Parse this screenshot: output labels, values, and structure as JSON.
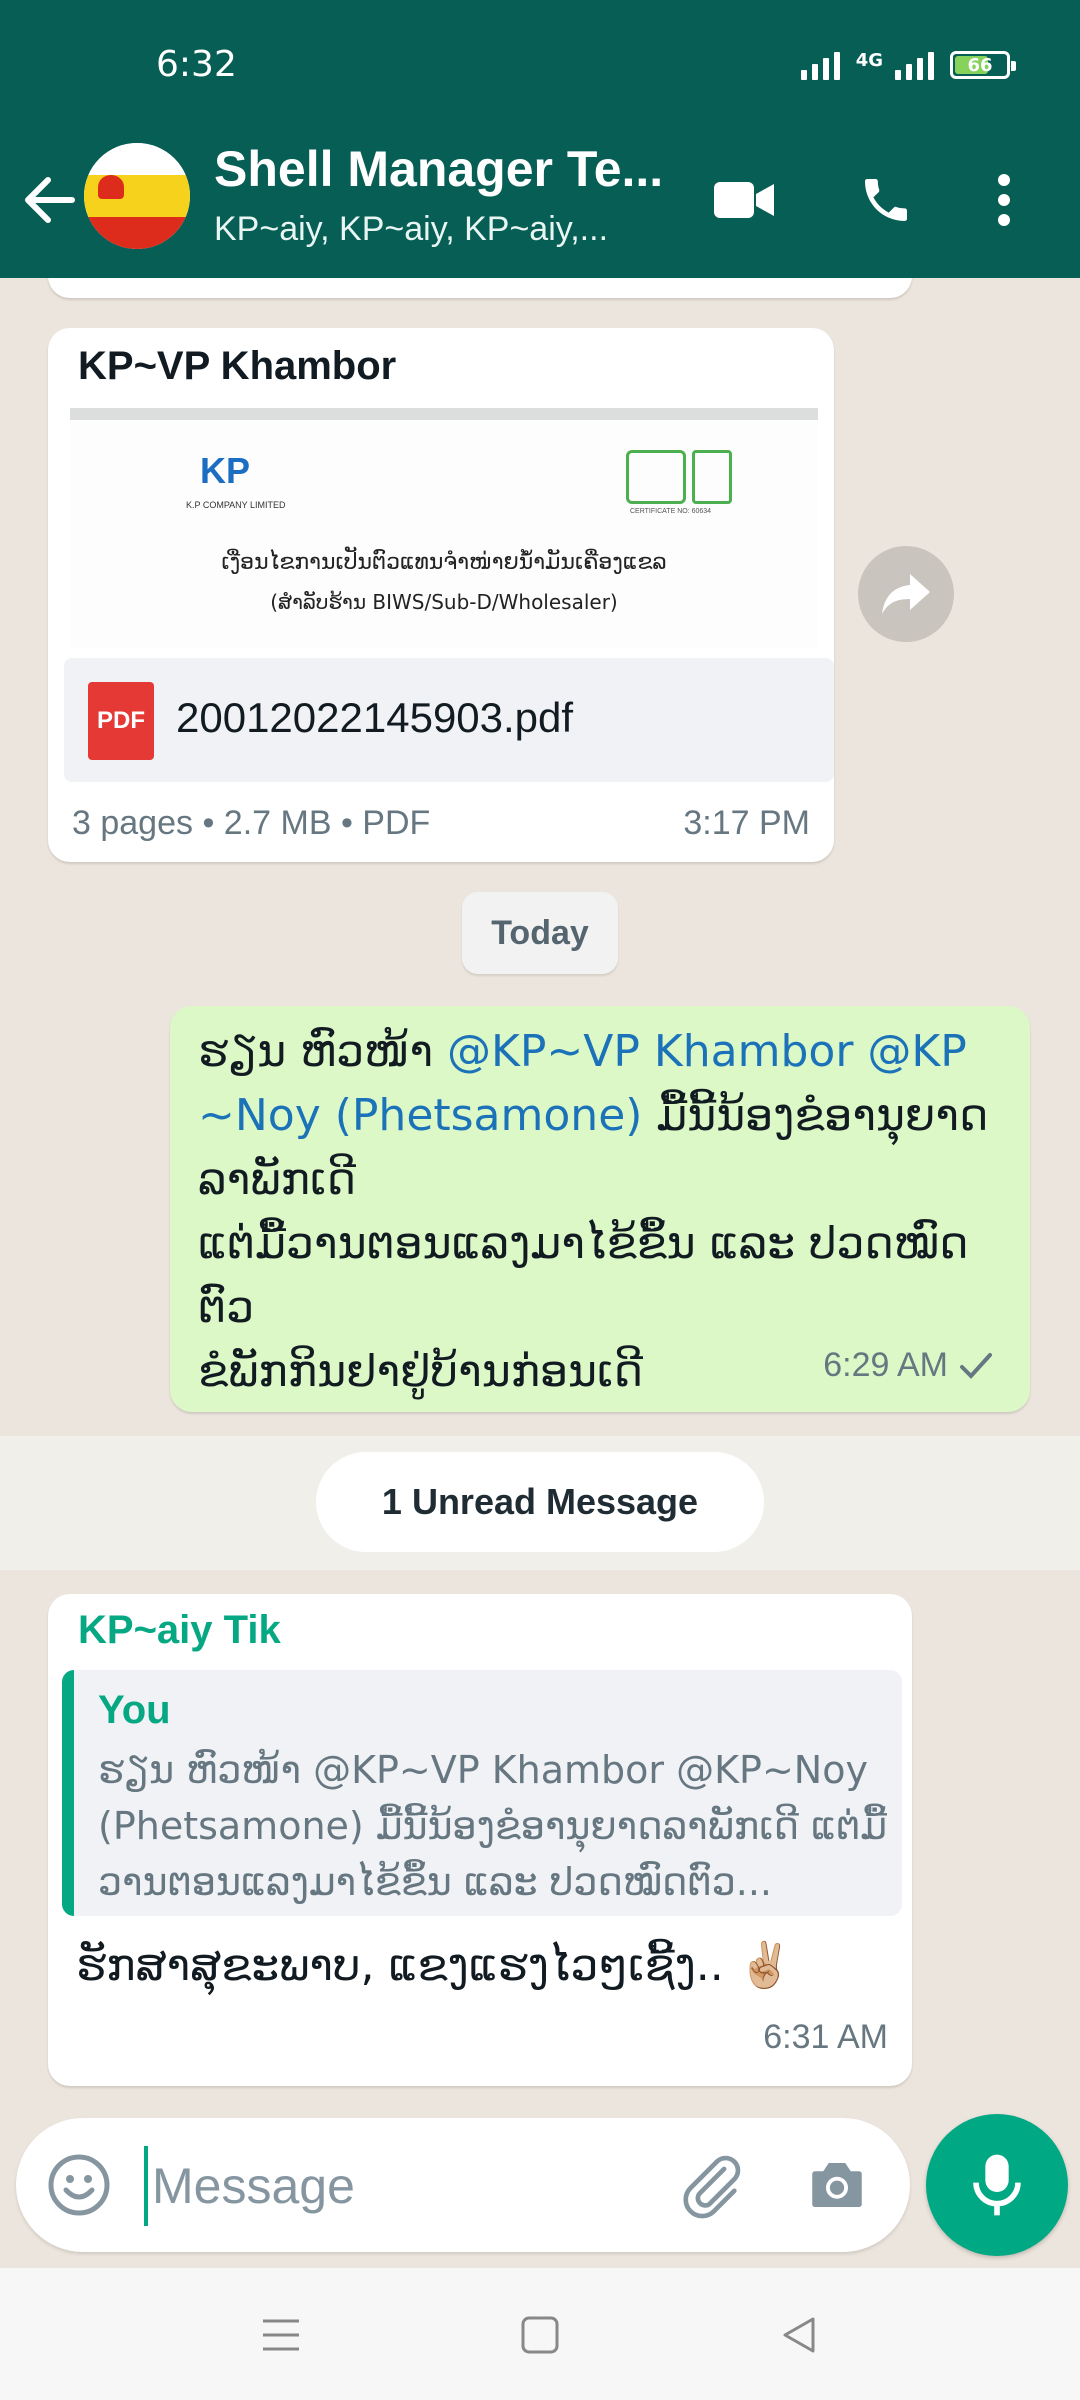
{
  "status_bar": {
    "time": "6:32",
    "network": "4G",
    "battery": "66",
    "battery_level": 0.66
  },
  "header": {
    "back_icon": "arrow-back-icon",
    "title": "Shell Manager Te...",
    "subtitle": "KP~aiy, KP~aiy, KP~aiy,...",
    "video_icon": "video-call-icon",
    "call_icon": "voice-call-icon",
    "menu_icon": "more-vert-icon"
  },
  "messages": [
    {
      "sender": "KP~VP Khambor",
      "sender_color": "#1b72b8",
      "doc_preview": {
        "company": "K.P COMPANY LIMITED",
        "logo_text": "KP",
        "cert_text": "CERTIFICATE NO: 60634",
        "line1": "ເງື່ອນໄຂການເປັນຕົວແທນຈຳໜ່າຍນ້ຳມັນເຄື່ອງແຂລ",
        "line2": "(ສຳລັບຮ້ານ  BIWS/Sub-D/Wholesaler)"
      },
      "file_name": "20012022145903.pdf",
      "file_type_icon": "PDF",
      "file_meta": "3 pages • 2.7 MB • PDF",
      "time": "3:17 PM",
      "forward_icon": "forward-icon"
    },
    {
      "date_label": "Today"
    },
    {
      "direction": "outgoing",
      "text_plain_1": "ຮຽນ ຫົວໜ້າ ",
      "mention_1": "@KP~VP Khambor",
      "text_plain_2": " ",
      "mention_2": "@KP\n~Noy (Phetsamone)",
      "text_plain_3": " ມື້ນີ້ນ້ອງຂໍອານຸຍາດ\nລາພັກເດີ\nແຕ່ມື້ວານຕອນແລງມາໄຂ້ຂຶ້ນ ແລະ ປວດໝົດ\nຕົວ\nຂໍພັກກິນຢາຢູ່ບ້ານກ່ອນເດີ",
      "time": "6:29 AM",
      "status_icon": "single-check-icon"
    },
    {
      "unread_label": "1 Unread Message"
    },
    {
      "sender": "KP~aiy Tik",
      "sender_color": "#06a884",
      "quote_author": "You",
      "quote_text": "ຮຽນ ຫົວໜ້າ @KP~VP Khambor @KP~Noy (Phetsamone) ມື້ນີ້ນ້ອງຂໍອານຸຍາດລາພັກເດີ ແຕ່ມື້ວານຕອນແລງມາໄຂ້ຂຶ້ນ ແລະ ປວດໝົດຕົວ...",
      "text": "ຮັກສາສຸຂະພາບ, ແຂງແຮງໄວໆເຊີ້ງ.. ✌🏼",
      "time": "6:31 AM"
    }
  ],
  "composer": {
    "emoji_icon": "emoji-icon",
    "placeholder": "Message",
    "attach_icon": "attach-icon",
    "camera_icon": "camera-icon",
    "mic_icon": "mic-icon"
  },
  "nav_bar": {
    "menu_icon": "menu-icon",
    "home_icon": "home-icon",
    "back_icon": "back-triangle-icon"
  },
  "colors": {
    "header": "#075e54",
    "accent": "#00a884",
    "outgoing_bubble": "#dcf8c6"
  }
}
